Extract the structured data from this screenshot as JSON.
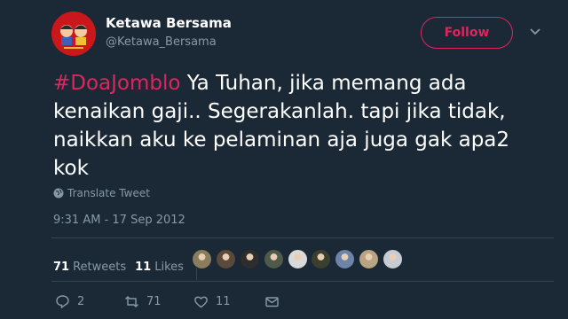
{
  "user": {
    "name": "Ketawa Bersama",
    "handle": "@Ketawa_Bersama"
  },
  "follow_label": "Follow",
  "tweet": {
    "hashtag": "#DoaJomblo",
    "text": " Ya Tuhan, jika memang ada kenaikan gaji.. Segerakanlah. tapi jika tidak, naikkan aku ke pelaminan aja juga gak apa2 kok"
  },
  "translate_label": "Translate Tweet",
  "timestamp": "9:31 AM - 17 Sep 2012",
  "stats": {
    "retweets_count": "71",
    "retweets_label": "Retweets",
    "likes_count": "11",
    "likes_label": "Likes"
  },
  "actions": {
    "reply_count": "2",
    "retweet_count": "71",
    "like_count": "11"
  },
  "colors": {
    "background": "#1b2836",
    "accent": "#e0245e",
    "muted": "#8899a6",
    "text": "#ffffff",
    "avatar_red": "#c9171c"
  },
  "liker_avatar_colors": [
    "#8a7d5e",
    "#5b4a3c",
    "#2d2d2d",
    "#4f5a4a",
    "#d9d9d9",
    "#3b3f2d",
    "#6d83a8",
    "#b8a382",
    "#c8ccd2"
  ]
}
